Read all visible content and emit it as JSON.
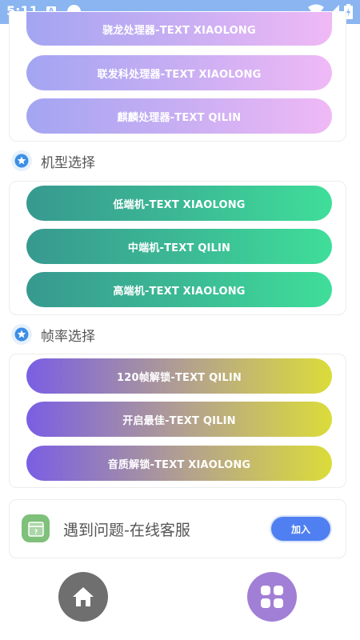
{
  "status_bar": {
    "time": "5:11",
    "notification_letter": "A",
    "icons": [
      "a-notification-icon",
      "circle-notification-icon",
      "wifi-icon",
      "signal-icon",
      "battery-icon"
    ]
  },
  "processor_section": {
    "buttons": [
      {
        "label": "骁龙处理器-TEXT XIAOLONG"
      },
      {
        "label": "联发科处理器-TEXT XIAOLONG"
      },
      {
        "label": "麒麟处理器-TEXT QILIN"
      }
    ]
  },
  "model_section": {
    "title": "机型选择",
    "icon": "star-icon",
    "buttons": [
      {
        "label": "低端机-TEXT XIAOLONG"
      },
      {
        "label": "中端机-TEXT QILIN"
      },
      {
        "label": "高端机-TEXT XIAOLONG"
      }
    ]
  },
  "framerate_section": {
    "title": "帧率选择",
    "icon": "star-icon",
    "buttons": [
      {
        "label": "120帧解锁-TEXT QILIN"
      },
      {
        "label": "开启最佳-TEXT QILIN"
      },
      {
        "label": "音质解锁-TEXT XIAOLONG"
      }
    ]
  },
  "service": {
    "title": "遇到问题-在线客服",
    "icon": "question-box-icon",
    "join_label": "加入"
  },
  "bottom_nav": {
    "items": [
      {
        "icon": "home-icon"
      },
      {
        "icon": "apps-grid-icon"
      }
    ]
  },
  "colors": {
    "status_bar": "#8ab5f0",
    "purple_gradient": [
      "#a3a5f2",
      "#efb9f5"
    ],
    "green_gradient": [
      "#37998f",
      "#3fde9a"
    ],
    "violet_gradient": [
      "#7a5ee4",
      "#dbdc3a"
    ],
    "section_icon": "#3d8fe6",
    "join_button": "#4f7ff0",
    "service_icon": "#7fc07a",
    "home_button": "#6f6f6f",
    "apps_button": "#a27fd6"
  }
}
